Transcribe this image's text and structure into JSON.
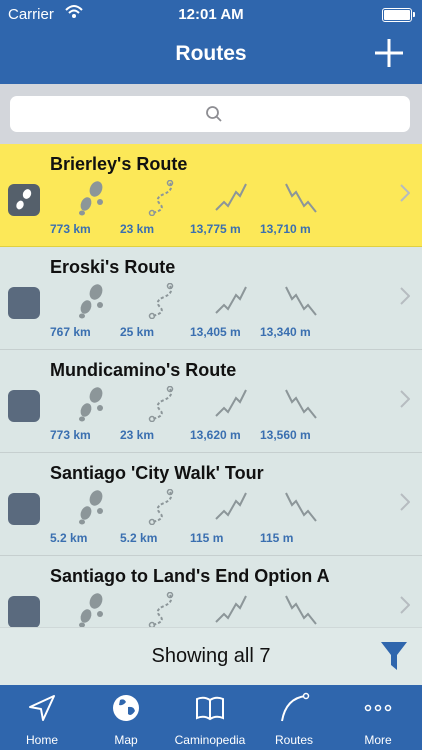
{
  "status_bar": {
    "carrier": "Carrier",
    "time": "12:01 AM"
  },
  "nav": {
    "title": "Routes",
    "add_icon": "plus-icon"
  },
  "search": {
    "placeholder": ""
  },
  "routes": [
    {
      "title": "Brierley's Route",
      "distance": "773 km",
      "stages": "23 km",
      "ascent": "13,775 m",
      "descent": "13,710 m",
      "selected": true
    },
    {
      "title": "Eroski's Route",
      "distance": "767 km",
      "stages": "25 km",
      "ascent": "13,405 m",
      "descent": "13,340 m",
      "selected": false
    },
    {
      "title": "Mundicamino's Route",
      "distance": "773 km",
      "stages": "23 km",
      "ascent": "13,620 m",
      "descent": "13,560 m",
      "selected": false
    },
    {
      "title": "Santiago 'City Walk' Tour",
      "distance": "5.2 km",
      "stages": "5.2 km",
      "ascent": "115 m",
      "descent": "115 m",
      "selected": false
    },
    {
      "title": "Santiago to Land's End Option A",
      "distance": "",
      "stages": "",
      "ascent": "",
      "descent": "",
      "selected": false
    }
  ],
  "footer": {
    "showing": "Showing all 7",
    "filter_icon": "filter-icon"
  },
  "tabs": [
    {
      "label": "Home",
      "icon": "location-arrow-icon"
    },
    {
      "label": "Map",
      "icon": "globe-icon"
    },
    {
      "label": "Caminopedia",
      "icon": "book-icon"
    },
    {
      "label": "Routes",
      "icon": "route-curve-icon"
    },
    {
      "label": "More",
      "icon": "more-dots-icon"
    }
  ],
  "colors": {
    "nav_bar": "#2f66ad",
    "selected_row": "#fce858",
    "row_bg": "#dbe6e5",
    "stat_value": "#3a6fb0"
  }
}
